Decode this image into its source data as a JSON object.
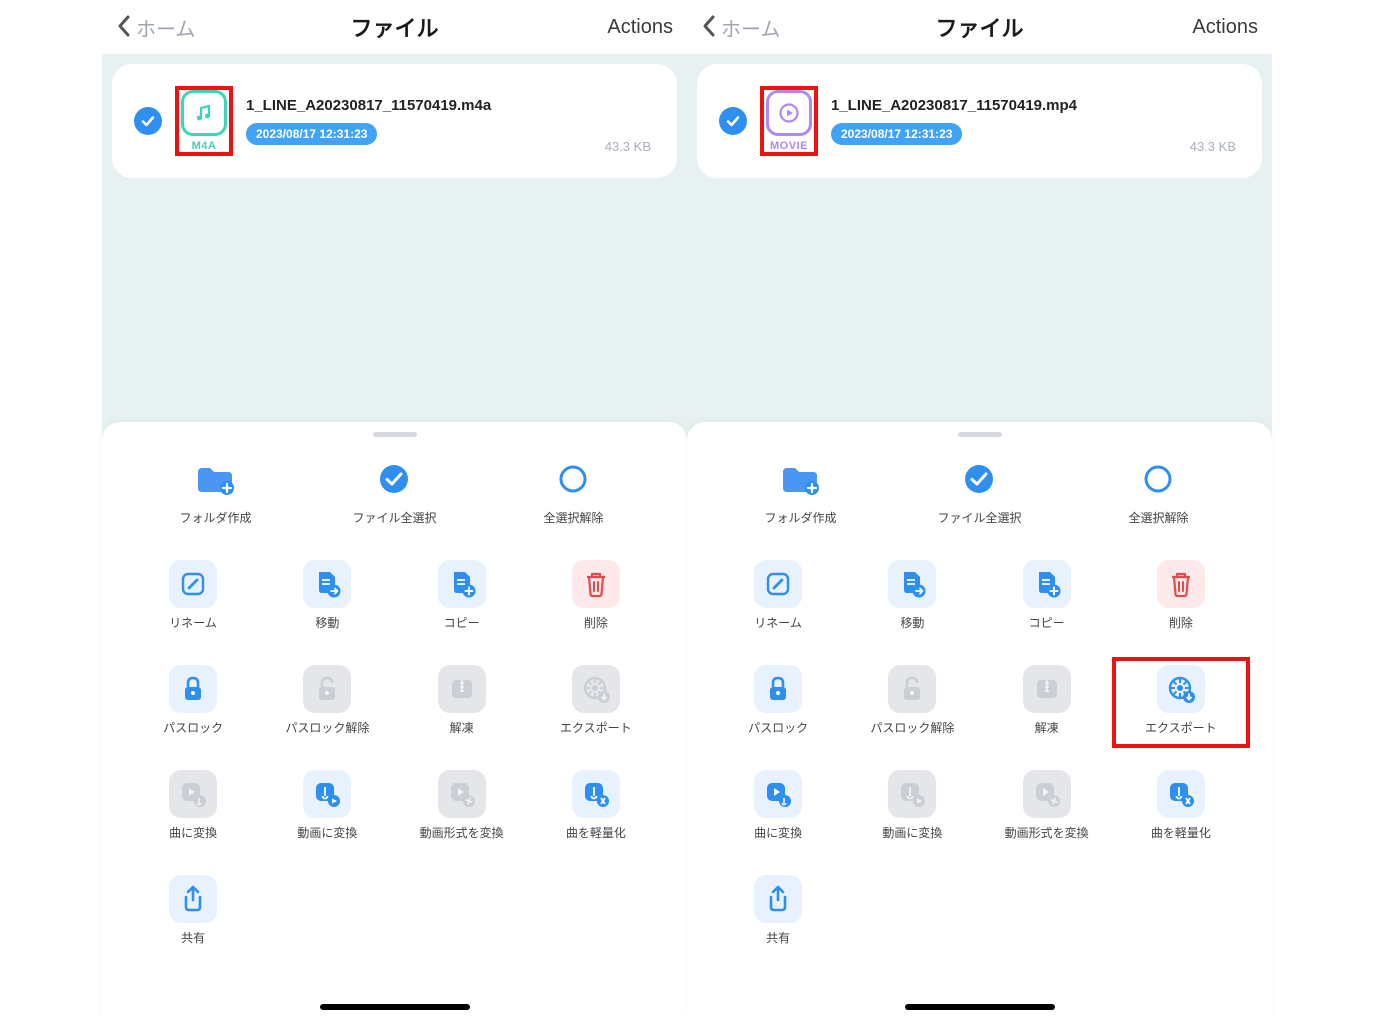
{
  "nav": {
    "back_label": "ホーム",
    "title": "ファイル",
    "actions_label": "Actions"
  },
  "files": {
    "left": {
      "name": "1_LINE_A20230817_11570419.m4a",
      "type_label": "M4A",
      "date": "2023/08/17 12:31:23",
      "size": "43.3 KB"
    },
    "right": {
      "name": "1_LINE_A20230817_11570419.mp4",
      "type_label": "MOVIE",
      "date": "2023/08/17 12:31:23",
      "size": "43.3 KB"
    }
  },
  "actions": {
    "row1": [
      {
        "id": "new-folder",
        "label": "フォルダ作成"
      },
      {
        "id": "select-all",
        "label": "ファイル全選択"
      },
      {
        "id": "deselect-all",
        "label": "全選択解除"
      }
    ],
    "row2": [
      {
        "id": "rename",
        "label": "リネーム"
      },
      {
        "id": "move",
        "label": "移動"
      },
      {
        "id": "copy",
        "label": "コピー"
      },
      {
        "id": "delete",
        "label": "削除"
      }
    ],
    "row3": [
      {
        "id": "passlock",
        "label": "パスロック"
      },
      {
        "id": "passlock-remove",
        "label": "パスロック解除"
      },
      {
        "id": "extract",
        "label": "解凍"
      },
      {
        "id": "export",
        "label": "エクスポート"
      }
    ],
    "row4": [
      {
        "id": "to-audio",
        "label": "曲に変換"
      },
      {
        "id": "to-video",
        "label": "動画に変換"
      },
      {
        "id": "video-format",
        "label": "動画形式を変換"
      },
      {
        "id": "optimize-audio",
        "label": "曲を軽量化"
      }
    ],
    "row5": [
      {
        "id": "share",
        "label": "共有"
      }
    ]
  },
  "colors": {
    "accent_blue": "#2e8ff0",
    "pill_blue": "#41a3f5",
    "tile_blue_soft": "#e8f1fe",
    "tile_grey": "#e4e6ea",
    "red_soft": "#fde9e9",
    "delete_red": "#e14b4b",
    "highlight_red": "#ee1111",
    "m4a_teal": "#3dd4b8",
    "movie_purple": "#b088f3"
  },
  "left_disabled": [
    "passlock-remove",
    "extract",
    "export",
    "to-audio",
    "video-format"
  ],
  "right_disabled": [
    "passlock-remove",
    "extract",
    "to-video",
    "video-format"
  ],
  "highlight_left": "file-icon",
  "highlight_right": "export"
}
